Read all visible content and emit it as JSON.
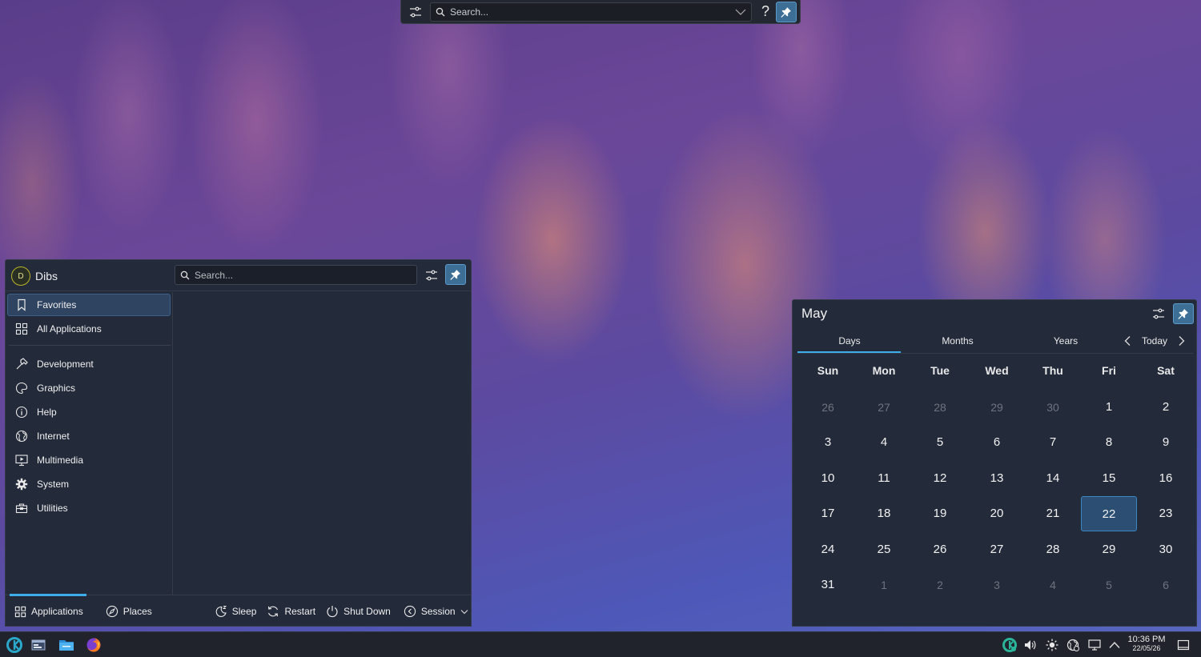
{
  "krunner": {
    "search_placeholder": "Search...",
    "help_label": "?"
  },
  "kickoff": {
    "user_initial": "D",
    "user_name": "Dibs",
    "search_placeholder": "Search...",
    "sidebar": {
      "items": [
        {
          "label": "Favorites",
          "icon": "bookmark-icon"
        },
        {
          "label": "All Applications",
          "icon": "grid-icon"
        },
        {
          "label": "Development",
          "icon": "hammer-icon"
        },
        {
          "label": "Graphics",
          "icon": "palette-icon"
        },
        {
          "label": "Help",
          "icon": "info-icon"
        },
        {
          "label": "Internet",
          "icon": "globe-icon"
        },
        {
          "label": "Multimedia",
          "icon": "monitor-play-icon"
        },
        {
          "label": "System",
          "icon": "gear-icon"
        },
        {
          "label": "Utilities",
          "icon": "toolbox-icon"
        }
      ]
    },
    "footer": {
      "tabs": [
        {
          "label": "Applications",
          "icon": "grid-icon"
        },
        {
          "label": "Places",
          "icon": "compass-icon"
        }
      ],
      "power": [
        {
          "label": "Sleep",
          "icon": "moon-icon"
        },
        {
          "label": "Restart",
          "icon": "restart-icon"
        },
        {
          "label": "Shut Down",
          "icon": "power-icon"
        },
        {
          "label": "Session",
          "icon": "session-icon"
        }
      ]
    }
  },
  "calendar": {
    "month": "May",
    "tabs": [
      "Days",
      "Months",
      "Years"
    ],
    "today_label": "Today",
    "weekdays": [
      "Sun",
      "Mon",
      "Tue",
      "Wed",
      "Thu",
      "Fri",
      "Sat"
    ],
    "weeks": [
      [
        "26",
        "27",
        "28",
        "29",
        "30",
        "1",
        "2"
      ],
      [
        "3",
        "4",
        "5",
        "6",
        "7",
        "8",
        "9"
      ],
      [
        "10",
        "11",
        "12",
        "13",
        "14",
        "15",
        "16"
      ],
      [
        "17",
        "18",
        "19",
        "20",
        "21",
        "22",
        "23"
      ],
      [
        "24",
        "25",
        "26",
        "27",
        "28",
        "29",
        "30"
      ],
      [
        "31",
        "1",
        "2",
        "3",
        "4",
        "5",
        "6"
      ]
    ],
    "selected_day": "22"
  },
  "taskbar": {
    "apps": [
      "application-launcher-icon",
      "overview-icon",
      "file-manager-icon",
      "firefox-icon"
    ],
    "tray": [
      "updates-icon",
      "volume-icon",
      "brightness-icon",
      "network-icon",
      "display-icon",
      "expand-tray-icon"
    ],
    "clock_time": "10:36 PM",
    "clock_date": "22/05/26"
  },
  "colors": {
    "accent": "#3daee9",
    "panel_bg": "#232a3a",
    "taskbar_bg": "#20232b"
  }
}
